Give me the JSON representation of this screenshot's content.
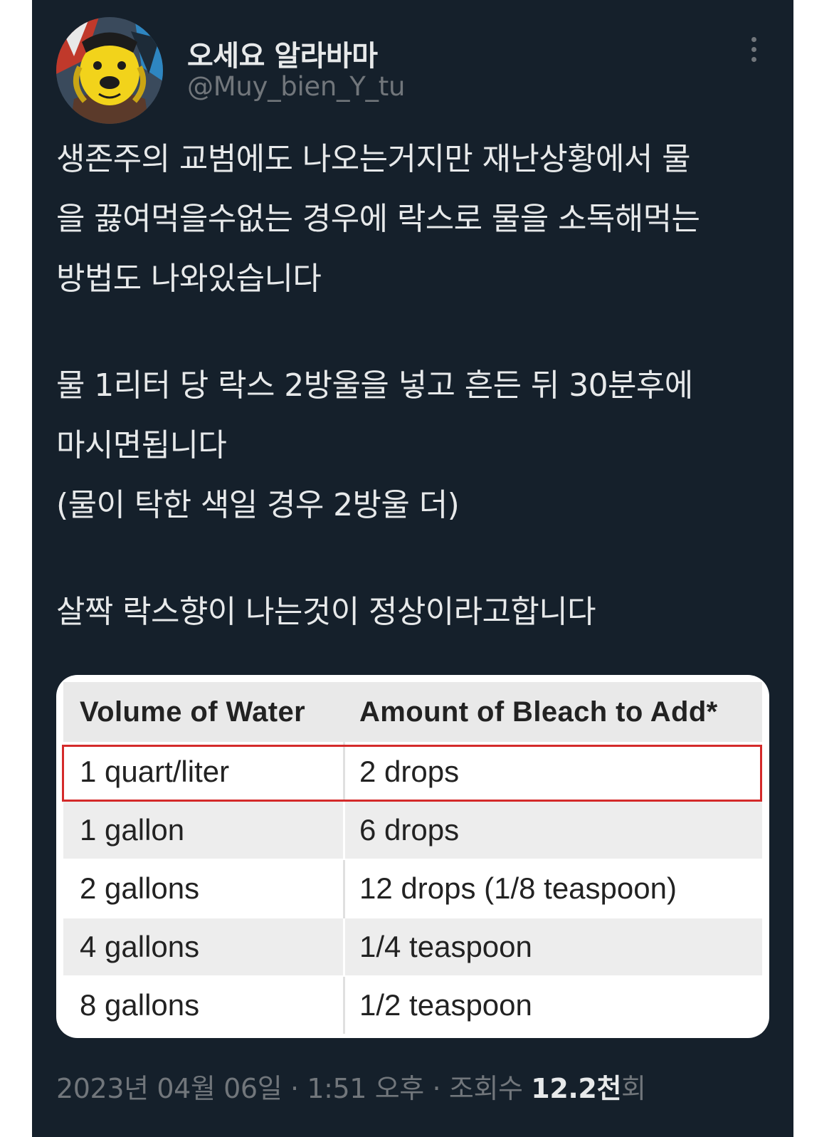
{
  "author": {
    "display_name": "오세요 알라바마",
    "handle": "@Muy_bien_Y_tu"
  },
  "body": {
    "lines": [
      "생존주의 교범에도 나오는거지만 재난상황에서 물",
      "을 끓여먹을수없는 경우에 락스로 물을 소독해먹는",
      "방법도 나와있습니다",
      "물 1리터 당 락스 2방울을 넣고 흔든 뒤 30분후에",
      "마시면됩니다",
      "(물이 탁한 색일 경우 2방울 더)",
      "살짝 락스향이 나는것이 정상이라고합니다"
    ]
  },
  "table": {
    "headers": [
      "Volume of Water",
      "Amount of Bleach to Add*"
    ],
    "rows": [
      [
        "1 quart/liter",
        "2 drops"
      ],
      [
        "1 gallon",
        "6 drops"
      ],
      [
        "2 gallons",
        "12 drops (1/8 teaspoon)"
      ],
      [
        "4 gallons",
        "1/4 teaspoon"
      ],
      [
        "8 gallons",
        "1/2 teaspoon"
      ]
    ],
    "highlight_color": "#d42a2a"
  },
  "meta": {
    "date": "2023년 04월 06일",
    "separator": " · ",
    "time": "1:51 오후",
    "views_label": "조회수 ",
    "views_count": "12.2천",
    "views_suffix": "회"
  },
  "icons": {
    "more": "more-options-icon"
  },
  "colors": {
    "background": "#15202b",
    "text": "#e7e9ea",
    "secondary_text": "#71767b"
  }
}
